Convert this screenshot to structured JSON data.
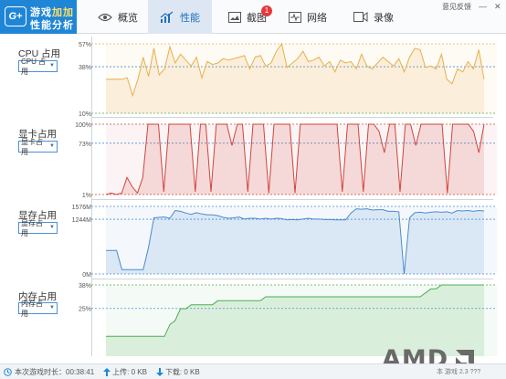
{
  "app": {
    "logo_badge": "G+",
    "logo_line1_a": "游戏",
    "logo_line1_b": "加加",
    "logo_line2": "性能分析"
  },
  "tabs": [
    {
      "label": "概览",
      "icon": "eye-icon"
    },
    {
      "label": "性能",
      "icon": "performance-chart-icon",
      "active": true
    },
    {
      "label": "截图",
      "icon": "screenshot-icon",
      "badge": "1"
    },
    {
      "label": "网络",
      "icon": "network-pulse-icon"
    },
    {
      "label": "录像",
      "icon": "video-camera-icon"
    }
  ],
  "header": {
    "feedback_label": "意见反馈",
    "minimize_glyph": "—",
    "close_glyph": "✕"
  },
  "panels": [
    {
      "title": "CPU 占用",
      "selector": "CPU 占用",
      "ymax_label": "57%",
      "ymid_label": "38%",
      "ymin_label": "10%"
    },
    {
      "title": "显卡占用",
      "selector": "显卡占用",
      "ymax_label": "100%",
      "ymid_label": "73%",
      "ymin_label": "1%"
    },
    {
      "title": "显存占用",
      "selector": "显存占用",
      "ymax_label": "1576M",
      "ymid_label": "1244M",
      "ymin_label": "0M"
    },
    {
      "title": "内存占用",
      "selector": "内存占用",
      "ymax_label": "38%",
      "ymid_label": "25%",
      "ymin_label": ""
    }
  ],
  "footer": {
    "session_label": "本次游戏时长：00:38:41",
    "upload_label": "上传: 0 KB",
    "download_label": "下载: 0 KB",
    "version_label": "本 游戏 2.3 ???"
  },
  "brand": {
    "amd_text": "AMD"
  },
  "colors": {
    "cpu": "#e8b04a",
    "gpu": "#d0443c",
    "vram": "#4a8bd0",
    "ram": "#4caf50",
    "accent": "#1f86d6"
  },
  "chart_data": [
    {
      "type": "line",
      "title": "CPU 占用",
      "ylim": [
        10,
        57
      ],
      "y_ticks": [
        "57%",
        "38%",
        "10%"
      ],
      "series": [
        {
          "values": [
            33,
            33,
            33,
            33,
            34,
            22,
            33,
            48,
            35,
            54,
            36,
            40,
            55,
            44,
            50,
            46,
            42,
            48,
            34,
            45,
            43,
            44,
            47,
            46,
            47,
            48,
            49,
            40,
            48,
            49,
            42,
            44,
            52,
            57,
            41,
            44,
            47,
            52,
            45,
            46,
            48,
            42,
            45,
            38,
            46,
            44,
            45,
            40,
            50,
            42,
            40,
            44,
            48,
            45,
            42,
            47,
            38,
            48,
            54,
            53,
            41,
            42,
            40,
            50,
            33,
            30,
            40,
            38,
            45,
            40,
            53,
            33
          ]
        }
      ]
    },
    {
      "type": "line",
      "title": "显卡占用",
      "ylim": [
        1,
        100
      ],
      "y_ticks": [
        "100%",
        "73%",
        "1%"
      ],
      "series": [
        {
          "values": [
            1,
            3,
            1,
            3,
            25,
            12,
            3,
            25,
            100,
            100,
            100,
            5,
            100,
            100,
            100,
            100,
            100,
            5,
            100,
            100,
            5,
            100,
            100,
            100,
            70,
            100,
            100,
            5,
            100,
            100,
            100,
            3,
            100,
            100,
            100,
            100,
            3,
            100,
            100,
            100,
            100,
            100,
            100,
            100,
            100,
            5,
            100,
            100,
            100,
            5,
            100,
            100,
            90,
            60,
            100,
            100,
            5,
            100,
            100,
            70,
            100,
            100,
            100,
            100,
            100,
            3,
            100,
            100,
            100,
            100,
            90,
            60,
            100
          ]
        }
      ]
    },
    {
      "type": "line",
      "title": "显存占用",
      "ylim": [
        0,
        1576
      ],
      "y_ticks": [
        "1576M",
        "1244M",
        "0M"
      ],
      "series": [
        {
          "values": [
            550,
            550,
            550,
            100,
            100,
            100,
            100,
            100,
            620,
            1310,
            1320,
            1330,
            1300,
            1480,
            1460,
            1420,
            1390,
            1430,
            1400,
            1380,
            1380,
            1360,
            1320,
            1300,
            1310,
            1330,
            1280,
            1300,
            1300,
            1280,
            1300,
            1280,
            1300,
            1290,
            1260,
            1270,
            1260,
            1280,
            1300,
            1280,
            1280,
            1270,
            1270,
            1260,
            1260,
            1260,
            1420,
            1520,
            1510,
            1520,
            1490,
            1500,
            1500,
            1460,
            1460,
            1450,
            0,
            1310,
            1430,
            1440,
            1420,
            1440,
            1450,
            1440,
            1450,
            1420,
            1480,
            1470,
            1480,
            1460,
            1480,
            1470
          ]
        }
      ]
    },
    {
      "type": "line",
      "title": "内存占用",
      "ylim": [
        20,
        38
      ],
      "y_ticks": [
        "38%",
        "25%"
      ],
      "series": [
        {
          "values": [
            25,
            25,
            25,
            25,
            25,
            25,
            25,
            25,
            25,
            25,
            25,
            25,
            28,
            29,
            32,
            32,
            33,
            33,
            33,
            33,
            33,
            34,
            34,
            34,
            34,
            34,
            34,
            34,
            34,
            34,
            35,
            35,
            35,
            35,
            35,
            35,
            35,
            35,
            35,
            35,
            35,
            35,
            35,
            35,
            35,
            35,
            35,
            35,
            35,
            35,
            35,
            35,
            35,
            35,
            35,
            35,
            35,
            35,
            35,
            35,
            36,
            37,
            37,
            38,
            38,
            38,
            38,
            38,
            38,
            38,
            38,
            38
          ]
        }
      ]
    }
  ]
}
